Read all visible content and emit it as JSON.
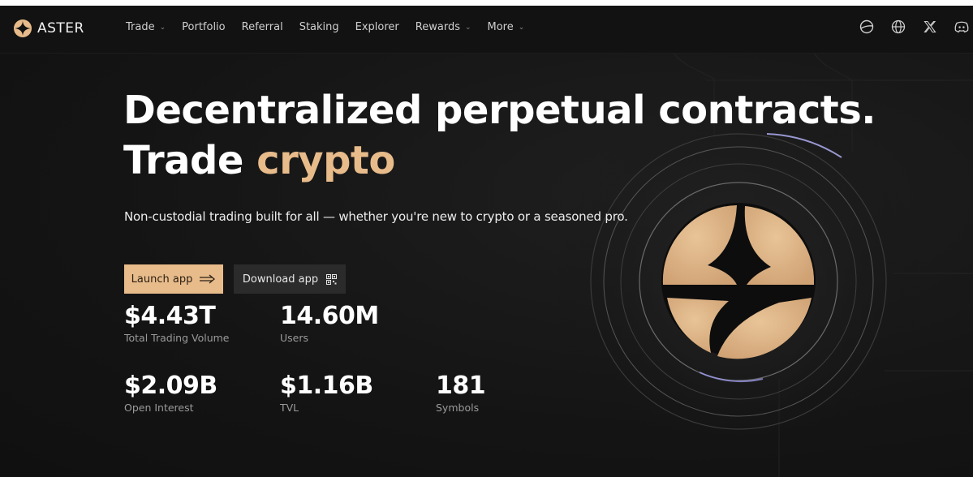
{
  "brand": {
    "name": "ASTER",
    "accent": "#e8bb8a"
  },
  "nav": {
    "items": [
      {
        "label": "Trade",
        "has_dropdown": true
      },
      {
        "label": "Portfolio",
        "has_dropdown": false
      },
      {
        "label": "Referral",
        "has_dropdown": false
      },
      {
        "label": "Staking",
        "has_dropdown": false
      },
      {
        "label": "Explorer",
        "has_dropdown": false
      },
      {
        "label": "Rewards",
        "has_dropdown": true
      },
      {
        "label": "More",
        "has_dropdown": true
      }
    ],
    "icons": [
      "theme-icon",
      "globe-icon",
      "x-twitter-icon",
      "discord-icon"
    ]
  },
  "hero": {
    "headline_line1": "Decentralized perpetual contracts.",
    "headline_line2_prefix": "Trade ",
    "headline_line2_accent": "crypto",
    "subtitle": "Non-custodial trading built for all — whether you're new to crypto or a seasoned pro.",
    "launch_label": "Launch app",
    "download_label": "Download app"
  },
  "stats": [
    {
      "value": "$4.43T",
      "label": "Total Trading Volume"
    },
    {
      "value": "14.60M",
      "label": "Users"
    },
    {
      "value": "$2.09B",
      "label": "Open Interest"
    },
    {
      "value": "$1.16B",
      "label": "TVL"
    },
    {
      "value": "181",
      "label": "Symbols"
    }
  ]
}
